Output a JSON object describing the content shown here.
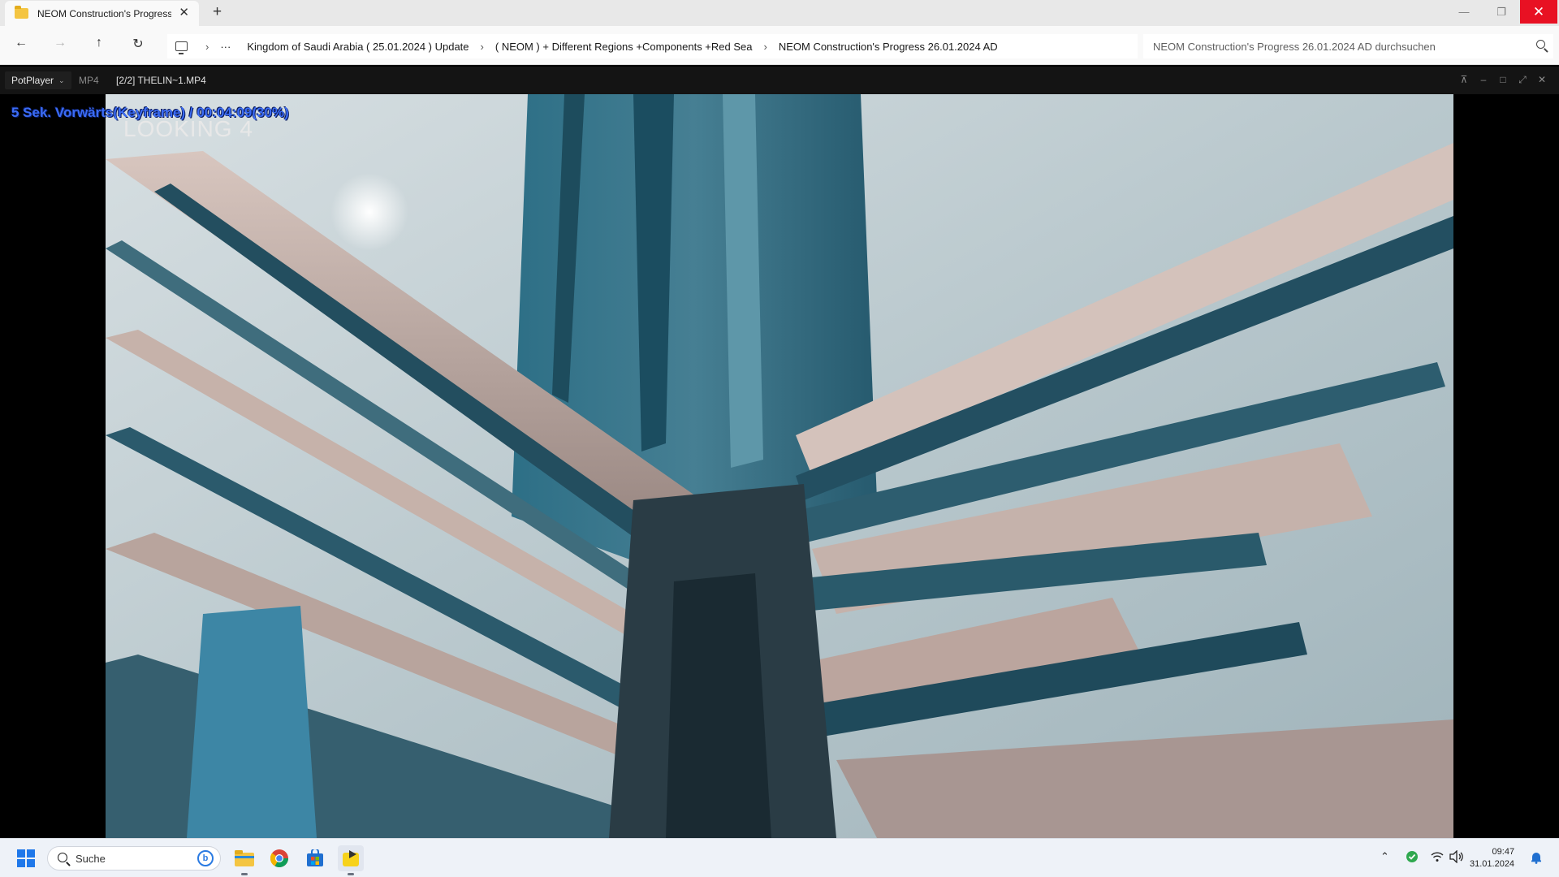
{
  "explorer": {
    "tab_title": "NEOM Construction's Progress",
    "tab_close": "✕",
    "new_tab": "+",
    "window_controls": {
      "minimize": "—",
      "restore": "❐",
      "close": "✕"
    },
    "nav": {
      "back": "←",
      "forward": "→",
      "up": "↑",
      "refresh": "↻",
      "overflow": "···"
    },
    "breadcrumbs": [
      "Kingdom of Saudi Arabia ( 25.01.2024 ) Update",
      "( NEOM ) + Different Regions +Components +Red Sea",
      "NEOM Construction's Progress 26.01.2024 AD"
    ],
    "breadcrumb_separator": "›",
    "search_placeholder": "NEOM Construction's Progress 26.01.2024 AD durchsuchen"
  },
  "player": {
    "brand": "PotPlayer",
    "brand_chevron": "⌄",
    "format": "MP4",
    "file": "[2/2] THELIN~1.MP4",
    "controls": {
      "pin": "⊼",
      "minimize": "–",
      "maximize": "□",
      "fullscreen": "⤢",
      "close": "✕"
    },
    "osd": "5  Sek. Vorwärts(Keyframe) / 00:04:09(30%)",
    "playback_position_percent": 30,
    "video_overlay_text": "LOOKING 4"
  },
  "taskbar": {
    "search_placeholder": "Suche",
    "bing_label": "b",
    "apps": [
      "file-explorer",
      "chrome",
      "microsoft-store",
      "potplayer"
    ],
    "tray_chevron": "⌃",
    "clock_time": "09:47",
    "clock_date": "31.01.2024"
  },
  "colors": {
    "osd_text": "#3b6cf5",
    "close_button": "#e81123",
    "start_blue": "#1f78ea"
  }
}
